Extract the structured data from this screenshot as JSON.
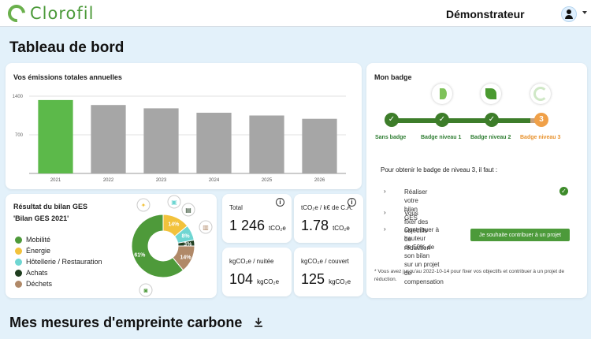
{
  "header": {
    "app_name": "Clorofil",
    "user_label": "Démonstrateur"
  },
  "page": {
    "title": "Tableau de bord",
    "section_title": "Mes mesures d'empreinte carbone"
  },
  "emissions": {
    "title": "Vos émissions totales annuelles"
  },
  "chart_data": [
    {
      "type": "bar",
      "title": "Vos émissions totales annuelles",
      "categories": [
        "2021",
        "2022",
        "2023",
        "2024",
        "2025",
        "2026"
      ],
      "values": [
        1330,
        1240,
        1180,
        1100,
        1050,
        990
      ],
      "ylim": [
        0,
        1400
      ],
      "yticks": [
        0,
        700,
        1400
      ],
      "ytick_labels": [
        "",
        "700",
        "1400"
      ],
      "grid": true,
      "colors": [
        "#5cb94a",
        "#a6a6a6",
        "#a6a6a6",
        "#a6a6a6",
        "#a6a6a6",
        "#a6a6a6"
      ]
    },
    {
      "type": "pie",
      "title": "Résultat du bilan GES",
      "categories": [
        "Mobilité",
        "Énergie",
        "Hôtellerie / Restauration",
        "Achats",
        "Déchets"
      ],
      "values": [
        61,
        14,
        8,
        3,
        14
      ],
      "value_labels": [
        "61%",
        "14%",
        "8%",
        "3%",
        "14%"
      ],
      "colors": [
        "#4e9a3a",
        "#f2c23c",
        "#6fd6d2",
        "#1f3d1f",
        "#b08968"
      ]
    }
  ],
  "ges": {
    "title": "Résultat du bilan GES",
    "subtitle": "'Bilan GES 2021'",
    "legend": [
      {
        "label": "Mobilité",
        "color": "#4e9a3a"
      },
      {
        "label": "Énergie",
        "color": "#f2c23c"
      },
      {
        "label": "Hôtellerie / Restauration",
        "color": "#6fd6d2"
      },
      {
        "label": "Achats",
        "color": "#1f3d1f"
      },
      {
        "label": "Déchets",
        "color": "#b08968"
      }
    ]
  },
  "kpis": {
    "total": {
      "label": "Total",
      "value": "1 246",
      "unit": "tCO₂e"
    },
    "ca": {
      "label": "tCO₂e / k€ de C.A.",
      "value": "1.78",
      "unit": "tCO₂e"
    },
    "nuitee": {
      "label": "kgCO₂e / nuitée",
      "value": "104",
      "unit": "kgCO₂e"
    },
    "couvert": {
      "label": "kgCO₂e / couvert",
      "value": "125",
      "unit": "kgCO₂e"
    }
  },
  "badge": {
    "title": "Mon badge",
    "steps": [
      {
        "label": "Sans badge",
        "number": "✓"
      },
      {
        "label": "Badge niveau 1",
        "number": "✓"
      },
      {
        "label": "Badge niveau 2",
        "number": "✓"
      },
      {
        "label": "Badge niveau 3",
        "number": "3"
      }
    ],
    "requirements_intro": "Pour obtenir le badge de niveau 3, il faut :",
    "requirements": [
      "Réaliser votre bilan GES",
      "Vous fixer des objectifs de réduction",
      "Contribuer à hauteur de 50% de son bilan sur un projet de compensation"
    ],
    "requirement_lines": [
      [
        "Réaliser votre bilan GES"
      ],
      [
        "Vous fixer des objectifs de réduction"
      ],
      [
        "Contribuer à hauteur",
        "de 50% de son bilan",
        "sur un projet de",
        "compensation"
      ]
    ],
    "contribute_button": "Je souhaite contribuer à un projet",
    "footnote": "* Vous avez jusqu'au 2022-10-14 pour fixer vos objectifs et contribuer à un projet de réduction."
  },
  "colors": {
    "brand_green": "#4c9a3a",
    "dark_green": "#3d7d2a",
    "pending_orange": "#f0a048",
    "page_bg": "#e3f1fa"
  }
}
